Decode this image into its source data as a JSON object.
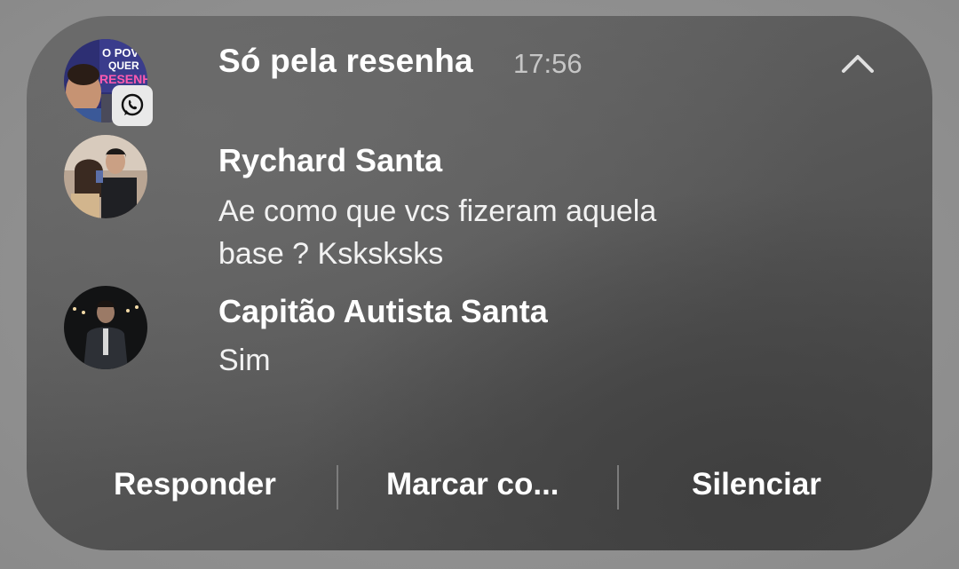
{
  "notification": {
    "app_icon": "whatsapp-icon",
    "group_name": "Só pela resenha",
    "time": "17:56",
    "collapse_icon": "chevron-up-icon",
    "group_avatar_text": [
      "O POVO",
      "QUER",
      "RESENHA"
    ]
  },
  "messages": [
    {
      "sender": "Rychard Santa",
      "text_lines": [
        "Ae como que vcs fizeram aquela",
        "base ? Ksksksks"
      ]
    },
    {
      "sender": "Capitão Autista Santa",
      "text_lines": [
        "Sim"
      ]
    }
  ],
  "actions": {
    "reply": "Responder",
    "mark": "Marcar co...",
    "mute": "Silenciar"
  },
  "colors": {
    "card_bg": "#5a5a5a",
    "text_primary": "#ffffff",
    "text_secondary": "#c6c6c6"
  }
}
